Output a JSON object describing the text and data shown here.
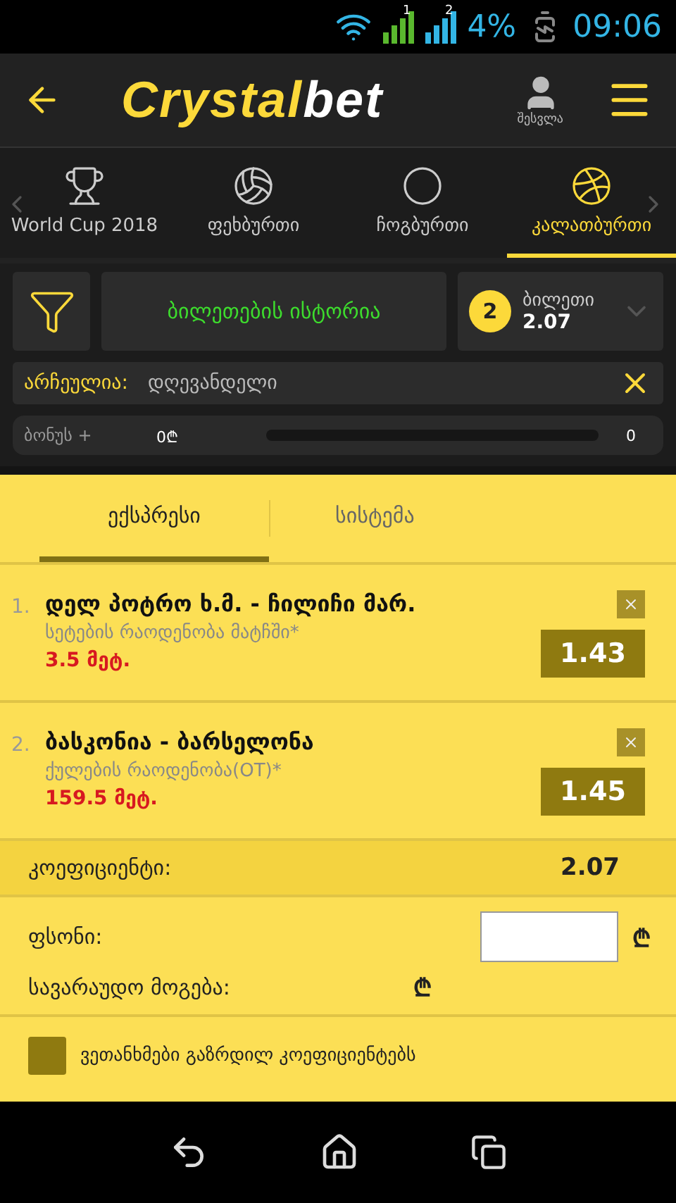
{
  "status_bar": {
    "sim_1": "1",
    "sim_2": "2",
    "battery": "4%",
    "time": "09:06"
  },
  "header": {
    "logo_part_1": "Crystal",
    "logo_part_2": "bet",
    "login": "შესვლა"
  },
  "sports": [
    {
      "label": "World Cup 2018",
      "selected": false
    },
    {
      "label": "ფეხბურთი",
      "selected": false
    },
    {
      "label": "ჩოგბურთი",
      "selected": false
    },
    {
      "label": "კალათბურთი",
      "selected": true
    }
  ],
  "toolbar": {
    "history": "ბილეთების ისტორია",
    "ticket_count": "2",
    "ticket_label": "ბილეთი",
    "ticket_odds": "2.07"
  },
  "filter": {
    "label": "არჩეულია:",
    "value": "დღევანდელი"
  },
  "bonus": {
    "label": "ბონუს +",
    "amount": "0₾",
    "level": 0,
    "count": "0"
  },
  "bet_tabs": [
    {
      "label": "ექსპრესი",
      "selected": true
    },
    {
      "label": "სისტემა",
      "selected": false
    }
  ],
  "bets": [
    {
      "number": "1.",
      "match": "დელ პოტრო ხ.მ. - ჩილიჩი მარ.",
      "market": "სეტების რაოდენობა მატჩში*",
      "pick": "3.5 მეტ.",
      "odds": "1.43"
    },
    {
      "number": "2.",
      "match": "ბასკონია - ბარსელონა",
      "market": "ქულების რაოდენობა(OT)*",
      "pick": "159.5 მეტ.",
      "odds": "1.45"
    }
  ],
  "summary": {
    "coef_label": "კოეფიციენტი:",
    "coef_value": "2.07",
    "stake_label": "ფსონი:",
    "stake_currency": "₾",
    "win_label": "სავარაუდო მოგება:",
    "win_currency": "₾"
  },
  "agree": {
    "label": "ვეთანხმები გაზრდილ კოეფიციენტებს",
    "checked": false
  }
}
